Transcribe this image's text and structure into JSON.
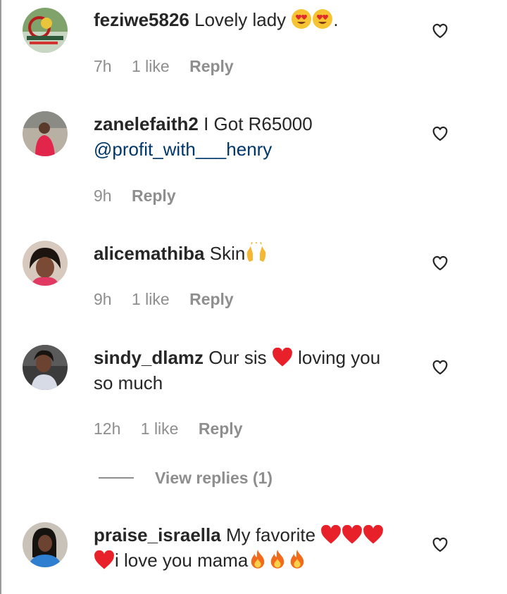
{
  "comments": [
    {
      "username": "feziwe5826",
      "text_parts": [
        "Lovely lady ",
        "."
      ],
      "emoji": [
        "heart-eyes",
        "heart-eyes"
      ],
      "time": "7h",
      "likes": "1 like",
      "reply": "Reply"
    },
    {
      "username": "zanelefaith2",
      "text": "I Got R65000",
      "mention": "@profit_with___henry",
      "time": "9h",
      "reply": "Reply"
    },
    {
      "username": "alicemathiba",
      "text": "Skin",
      "emoji": [
        "raising-hands"
      ],
      "time": "9h",
      "likes": "1 like",
      "reply": "Reply"
    },
    {
      "username": "sindy_dlamz",
      "text_parts": [
        "Our sis ",
        " loving you so much"
      ],
      "emoji": [
        "red-heart"
      ],
      "time": "12h",
      "likes": "1 like",
      "reply": "Reply"
    },
    {
      "username": "praise_israella",
      "text_parts": [
        "My favorite ",
        "i love you mama"
      ],
      "emoji": [
        "red-heart",
        "red-heart",
        "red-heart",
        "red-heart",
        "fire",
        "fire",
        "fire"
      ]
    }
  ],
  "view_replies": "View replies (1)",
  "colors": {
    "text": "#262626",
    "meta": "#8e8e8e",
    "mention": "#00376b",
    "heart": "#e8202a"
  },
  "icons": {
    "like": "heart-outline-icon"
  }
}
